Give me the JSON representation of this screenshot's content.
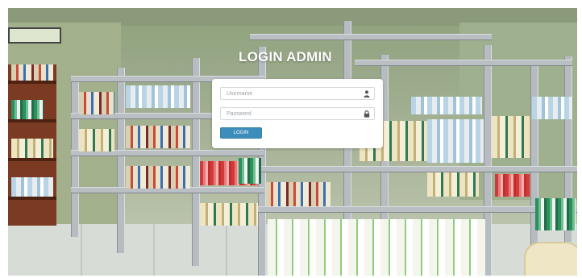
{
  "page": {
    "title": "LOGIN ADMIN"
  },
  "login_form": {
    "username_placeholder": "Username",
    "password_placeholder": "Password",
    "login_button_label": "LOGIN",
    "button_color": "#3c8dbc",
    "username_icon": "user-icon",
    "password_icon": "lock-icon"
  },
  "background": {
    "scene": "library-bookshelves-photo"
  }
}
